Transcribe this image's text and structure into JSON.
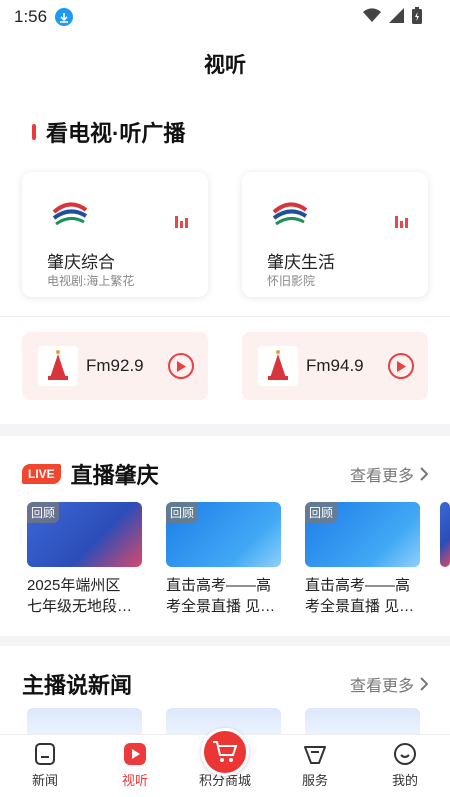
{
  "status": {
    "time": "1:56"
  },
  "header": {
    "title": "视听"
  },
  "tv_radio": {
    "title": "看电视·听广播",
    "tv": [
      {
        "name": "肇庆综合",
        "program": "电视剧:海上繁花"
      },
      {
        "name": "肇庆生活",
        "program": "怀旧影院"
      }
    ],
    "fm": [
      {
        "name": "Fm92.9"
      },
      {
        "name": "Fm94.9"
      }
    ]
  },
  "live": {
    "badge": "LIVE",
    "title": "直播肇庆",
    "see_more": "查看更多",
    "replay_label": "回顾",
    "items": [
      {
        "caption_line1": "2025年端州区",
        "caption_line2": "七年级无地段…"
      },
      {
        "caption_line1": "直击高考——高",
        "caption_line2": "考全景直播 见…"
      },
      {
        "caption_line1": "直击高考——高",
        "caption_line2": "考全景直播 见…"
      }
    ]
  },
  "anchor_news": {
    "title": "主播说新闻",
    "see_more": "查看更多"
  },
  "bottom_nav": {
    "items": [
      {
        "label": "新闻"
      },
      {
        "label": "视听"
      },
      {
        "label": "积分商城"
      },
      {
        "label": "服务"
      },
      {
        "label": "我的"
      }
    ]
  },
  "colors": {
    "accent": "#ee3a3a",
    "fm_bg": "#fdf1ef"
  }
}
